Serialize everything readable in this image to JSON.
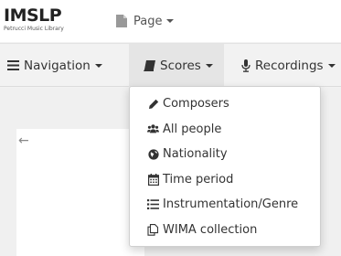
{
  "logo": {
    "name": "IMSLP",
    "subtitle": "Petrucci Music Library"
  },
  "page_menu": {
    "label": "Page"
  },
  "navbar": {
    "navigation_label": "Navigation",
    "scores_label": "Scores",
    "recordings_label": "Recordings"
  },
  "dropdown": {
    "items": [
      {
        "label": "Composers",
        "icon": "pencil-icon"
      },
      {
        "label": "All people",
        "icon": "users-icon"
      },
      {
        "label": "Nationality",
        "icon": "globe-icon"
      },
      {
        "label": "Time period",
        "icon": "calendar-icon"
      },
      {
        "label": "Instrumentation/Genre",
        "icon": "list-icon"
      },
      {
        "label": "WIMA collection",
        "icon": "copy-icon"
      }
    ]
  },
  "content": {
    "back_arrow": "←"
  }
}
